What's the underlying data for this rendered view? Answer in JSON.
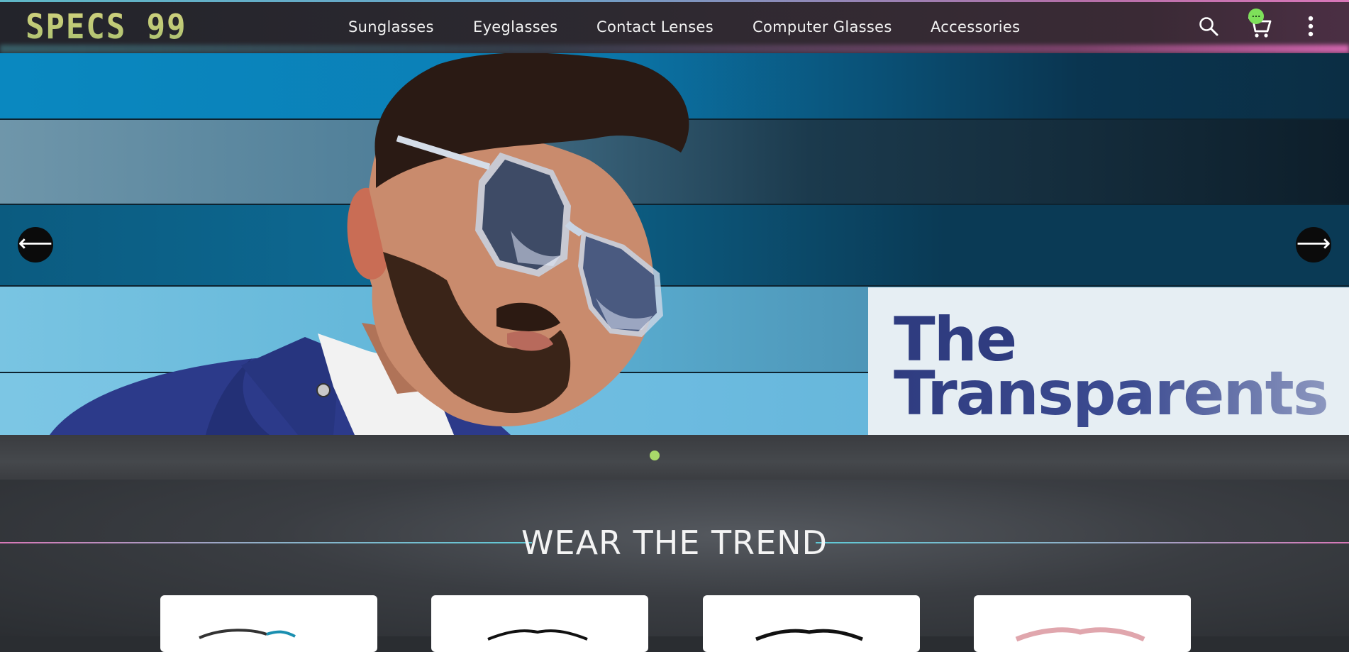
{
  "header": {
    "logo": "SPECS 99",
    "nav": [
      "Sunglasses",
      "Eyeglasses",
      "Contact Lenses",
      "Computer Glasses",
      "Accessories"
    ],
    "icons": [
      "search-icon",
      "cart-icon",
      "more-vertical-icon"
    ],
    "cart_badge": "..."
  },
  "hero": {
    "promo_line1": "The",
    "promo_line2": "Transparents",
    "prev_label": "⟵",
    "next_label": "⟶",
    "slide_count": 1,
    "active_slide": 1
  },
  "section": {
    "title": "WEAR THE TREND",
    "products": [
      "product-card-1",
      "product-card-2",
      "product-card-3",
      "product-card-4"
    ]
  },
  "colors": {
    "accent_green": "#a8d86a",
    "logo_yellow": "#c9c976",
    "promo_navy": "#2f3c80"
  }
}
